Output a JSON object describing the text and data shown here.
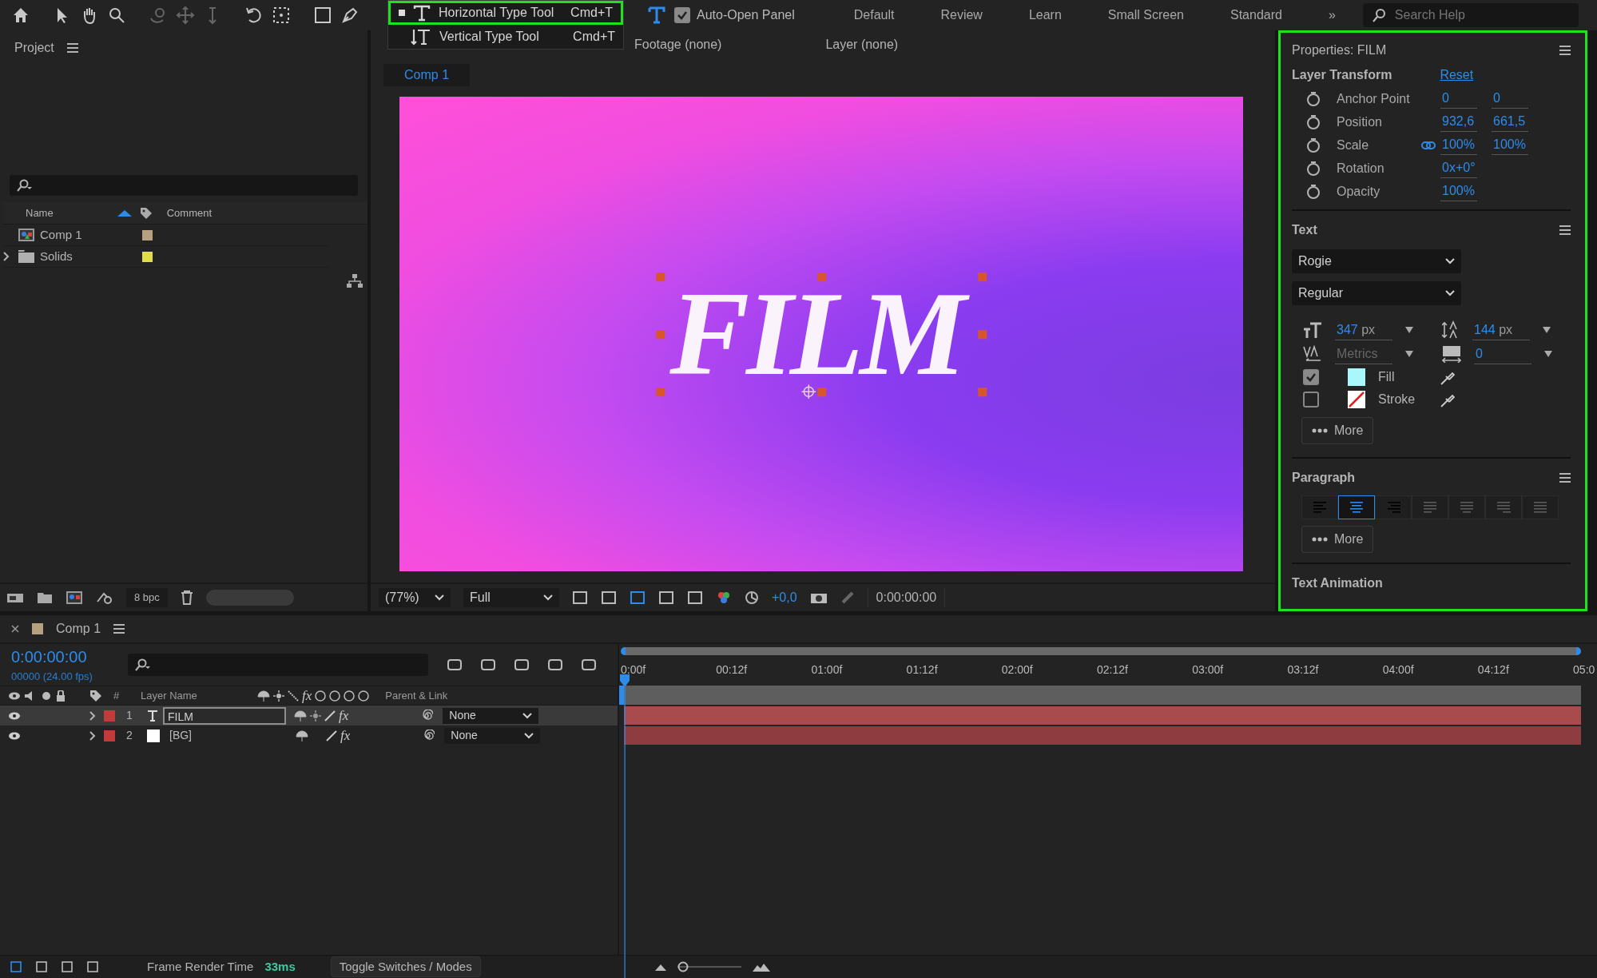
{
  "toolbar": {
    "tools": [
      {
        "kind": "home",
        "selected": false,
        "disabled": false
      },
      {
        "kind": "select",
        "selected": false,
        "disabled": false
      },
      {
        "kind": "hand",
        "selected": false,
        "disabled": false
      },
      {
        "kind": "zoom",
        "selected": false,
        "disabled": false
      },
      {
        "kind": "orbit",
        "selected": false,
        "disabled": true
      },
      {
        "kind": "pan",
        "selected": false,
        "disabled": true
      },
      {
        "kind": "dolly",
        "selected": false,
        "disabled": true
      },
      {
        "kind": "rotate",
        "selected": false,
        "disabled": false
      },
      {
        "kind": "anchor",
        "selected": false,
        "disabled": false
      },
      {
        "kind": "rectangle",
        "selected": false,
        "disabled": false
      },
      {
        "kind": "pen",
        "selected": false,
        "disabled": false
      },
      {
        "kind": "type",
        "selected": true,
        "disabled": false
      }
    ],
    "auto_open_panel": {
      "label": "Auto-Open Panel",
      "checked": true
    },
    "workspaces": [
      {
        "label": "Default"
      },
      {
        "label": "Review"
      },
      {
        "label": "Learn"
      },
      {
        "label": "Small Screen"
      },
      {
        "label": "Standard"
      }
    ],
    "workspaces_more": "»",
    "search": {
      "placeholder": "Search Help"
    }
  },
  "tool_menu": {
    "items": [
      {
        "kind": "horizontal",
        "label": "Horizontal Type Tool",
        "shortcut": "Cmd+T",
        "selected": true
      },
      {
        "kind": "vertical",
        "label": "Vertical Type Tool",
        "shortcut": "Cmd+T",
        "selected": false
      }
    ]
  },
  "project": {
    "title": "Project",
    "columns": [
      "Name",
      "Comment"
    ],
    "items": [
      {
        "kind": "composition",
        "name": "Comp 1",
        "color": "#b5a07f"
      },
      {
        "kind": "folder",
        "name": "Solids",
        "color": "#e2dc4a"
      }
    ],
    "bit_depth": "8 bpc"
  },
  "viewer": {
    "tabs": [
      "Footage (none)",
      "Layer (none)"
    ],
    "comp_tab": "Comp 1",
    "text": "FILM",
    "magnification": "(77%)",
    "resolution": "Full",
    "exposure": "+0,0",
    "timecode": "0:00:00:00"
  },
  "properties": {
    "title": "Properties: FILM",
    "transform": {
      "title": "Layer Transform",
      "reset": "Reset",
      "rows": [
        {
          "label": "Anchor Point",
          "values": [
            "0",
            "0"
          ],
          "linked": false
        },
        {
          "label": "Position",
          "values": [
            "932,6",
            "661,5"
          ],
          "linked": false
        },
        {
          "label": "Scale",
          "values": [
            "100%",
            "100%"
          ],
          "linked": true
        },
        {
          "label": "Rotation",
          "values": [
            "0x+0°"
          ],
          "linked": false
        },
        {
          "label": "Opacity",
          "values": [
            "100%"
          ],
          "linked": false
        }
      ]
    },
    "text": {
      "title": "Text",
      "font": "Rogie",
      "style": "Regular",
      "size": {
        "value": "347",
        "unit": "px"
      },
      "leading": {
        "value": "144",
        "unit": "px"
      },
      "kerning": "Metrics",
      "tracking": "0",
      "fill": {
        "label": "Fill",
        "checked": true,
        "color": "#aaf7fb"
      },
      "stroke": {
        "label": "Stroke",
        "checked": false
      },
      "more": "More"
    },
    "paragraph": {
      "title": "Paragraph",
      "alignments": [
        {
          "kind": "left",
          "selected": false,
          "disabled": false
        },
        {
          "kind": "center",
          "selected": true,
          "disabled": false
        },
        {
          "kind": "right",
          "selected": false,
          "disabled": false
        },
        {
          "kind": "justify-left",
          "selected": false,
          "disabled": true
        },
        {
          "kind": "justify-center",
          "selected": false,
          "disabled": true
        },
        {
          "kind": "justify-right",
          "selected": false,
          "disabled": true
        },
        {
          "kind": "justify-all",
          "selected": false,
          "disabled": true
        }
      ],
      "more": "More"
    },
    "animation": {
      "title": "Text Animation"
    }
  },
  "timeline": {
    "tab": {
      "label": "Comp 1",
      "color": "#b5a07f"
    },
    "timecode": "0:00:00:00",
    "frame_info": "00000 (24.00 fps)",
    "columns": [
      "#",
      "Layer Name",
      "Parent & Link"
    ],
    "fx_header": "fx",
    "layers": [
      {
        "number": "1",
        "kind": "text",
        "name": "FILM",
        "selected": true,
        "color": "#c23b3b",
        "effects": "fx",
        "parent": "None"
      },
      {
        "number": "2",
        "kind": "solid",
        "name": "[BG]",
        "selected": false,
        "color": "#c23b3b",
        "effects": "fx",
        "parent": "None"
      }
    ],
    "ruler": [
      "0:00f",
      "00:12f",
      "01:00f",
      "01:12f",
      "02:00f",
      "02:12f",
      "03:00f",
      "03:12f",
      "04:00f",
      "04:12f",
      "05:0"
    ]
  },
  "status_bar": {
    "render_label": "Frame Render Time",
    "render_time": "33ms",
    "toggle": "Toggle Switches / Modes"
  }
}
